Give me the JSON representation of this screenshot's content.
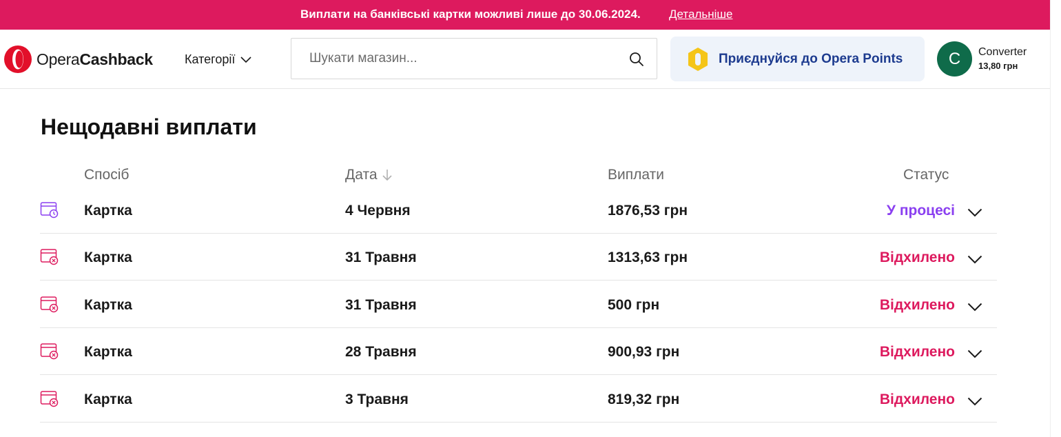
{
  "banner": {
    "text": "Виплати на банківські картки можливі лише до 30.06.2024.",
    "link": "Детальніше",
    "color": "#dd1a5e"
  },
  "header": {
    "logo": {
      "light": "Opera",
      "bold": "Cashback",
      "icon": "opera-logo-icon"
    },
    "categories_label": "Категорії",
    "search": {
      "placeholder": "Шукати магазин...",
      "value": ""
    },
    "points_label": "Приєднуйся до Opera Points",
    "user": {
      "initial": "C",
      "name": "Converter",
      "balance": "13,80 грн"
    }
  },
  "payouts": {
    "title": "Нещодавні виплати",
    "columns": {
      "method": "Спосіб",
      "date": "Дата",
      "amount": "Виплати",
      "status": "Статус"
    },
    "rows": [
      {
        "method": "Картка",
        "date": "4 Червня",
        "amount": "1876,53 грн",
        "status": "У процесі",
        "status_color": "#8a3ff0",
        "icon": "card-pending-icon"
      },
      {
        "method": "Картка",
        "date": "31 Травня",
        "amount": "1313,63 грн",
        "status": "Відхилено",
        "status_color": "#dd1a5e",
        "icon": "card-rejected-icon"
      },
      {
        "method": "Картка",
        "date": "31 Травня",
        "amount": "500 грн",
        "status": "Відхилено",
        "status_color": "#dd1a5e",
        "icon": "card-rejected-icon"
      },
      {
        "method": "Картка",
        "date": "28 Травня",
        "amount": "900,93 грн",
        "status": "Відхилено",
        "status_color": "#dd1a5e",
        "icon": "card-rejected-icon"
      },
      {
        "method": "Картка",
        "date": "3 Травня",
        "amount": "819,32 грн",
        "status": "Відхилено",
        "status_color": "#dd1a5e",
        "icon": "card-rejected-icon"
      }
    ]
  }
}
